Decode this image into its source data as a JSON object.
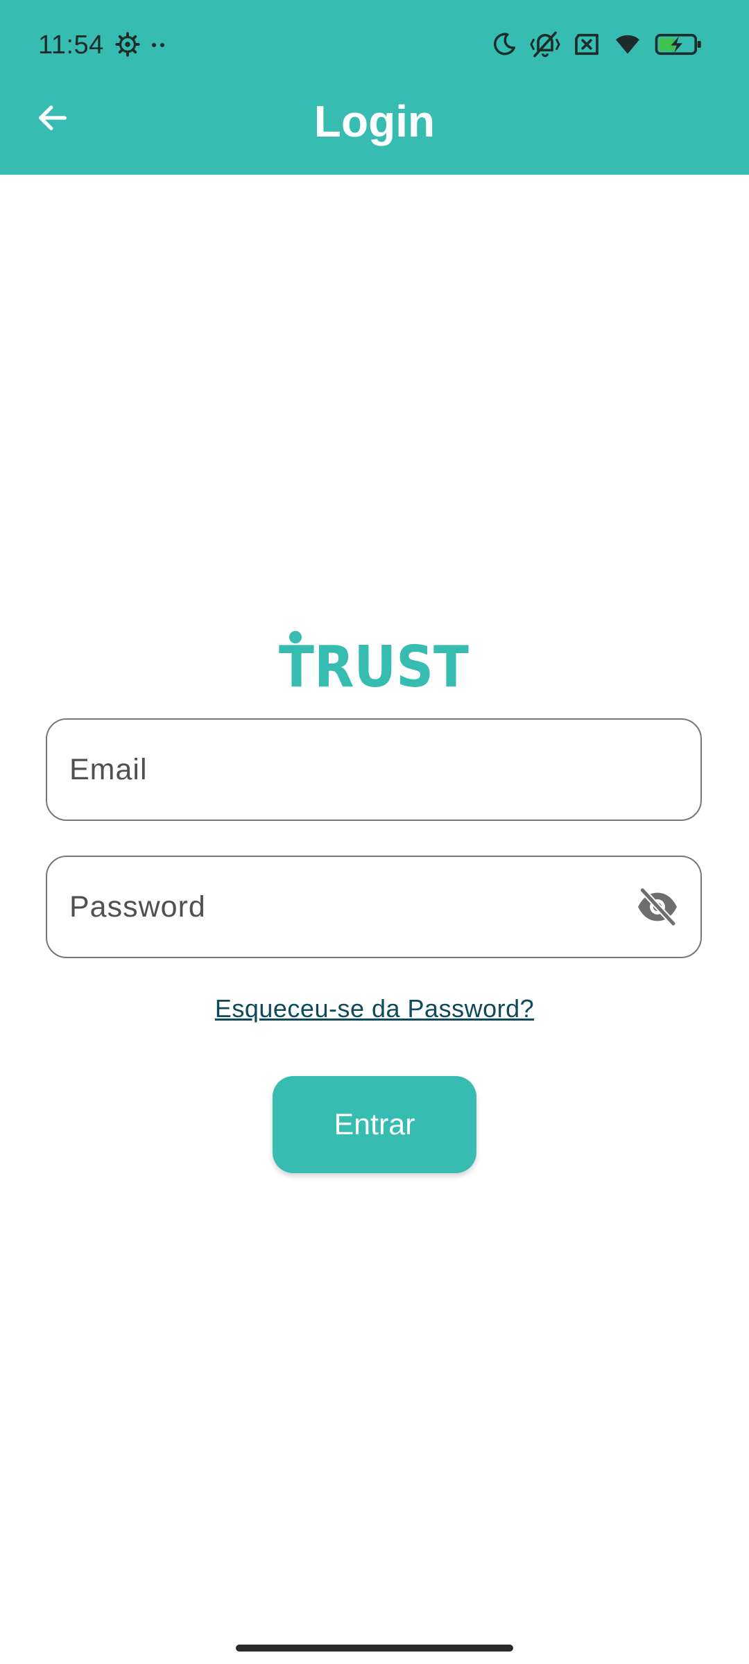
{
  "status_bar": {
    "time": "11:54",
    "left_icons": [
      "settings-gear-icon",
      "more-dots-icon"
    ],
    "right_icons": [
      "do-not-disturb-moon-icon",
      "vibrate-off-icon",
      "no-sim-icon",
      "wifi-icon",
      "battery-charging-icon"
    ]
  },
  "app_bar": {
    "title": "Login",
    "back_icon": "arrow-back-icon",
    "background_color": "#36bcb1"
  },
  "logo": {
    "text": "TRUST",
    "color": "#36bcb1"
  },
  "form": {
    "email": {
      "placeholder": "Email",
      "value": ""
    },
    "password": {
      "placeholder": "Password",
      "value": "",
      "toggle_icon": "eye-off-icon"
    },
    "forgot_password_label": "Esqueceu-se da Password?",
    "submit_label": "Entrar"
  },
  "colors": {
    "accent": "#36bcb1",
    "link": "#0f4a5a",
    "field_border": "#767676"
  }
}
